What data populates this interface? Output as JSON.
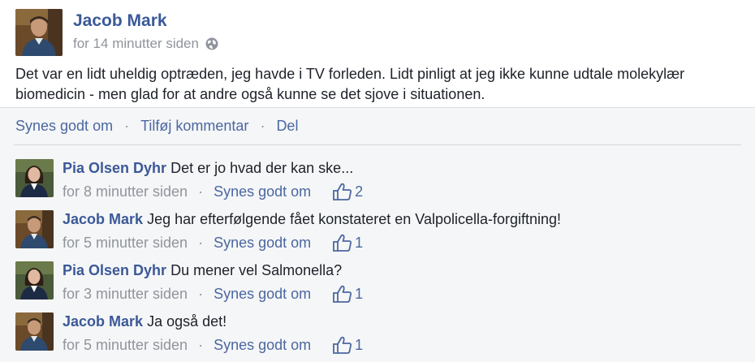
{
  "post": {
    "author": "Jacob Mark",
    "time": "for 14 minutter siden",
    "audience_icon": "globe-icon",
    "text": "Det var en lidt uheldig optræden, jeg havde i TV forleden. Lidt pinligt at jeg ikke kunne udtale molekylær biomedicin - men glad for at andre også kunne se det sjove i situationen."
  },
  "actions": {
    "like": "Synes godt om",
    "comment": "Tilføj kommentar",
    "share": "Del",
    "separator": "·"
  },
  "comments": [
    {
      "author": "Pia Olsen Dyhr",
      "text": "Det er jo hvad der kan ske...",
      "time": "for 8 minutter siden",
      "like_label": "Synes godt om",
      "likes": "2",
      "avatar": "female"
    },
    {
      "author": "Jacob Mark",
      "text": "Jeg har efterfølgende fået konstateret en Valpolicella-forgiftning!",
      "time": "for 5 minutter siden",
      "like_label": "Synes godt om",
      "likes": "1",
      "avatar": "male"
    },
    {
      "author": "Pia Olsen Dyhr",
      "text": "Du mener vel Salmonella?",
      "time": "for 3 minutter siden",
      "like_label": "Synes godt om",
      "likes": "1",
      "avatar": "female"
    },
    {
      "author": "Jacob Mark",
      "text": "Ja også det!",
      "time": "for 5 minutter siden",
      "like_label": "Synes godt om",
      "likes": "1",
      "avatar": "male"
    }
  ],
  "colors": {
    "link": "#3b5998",
    "action": "#4b67a1",
    "meta": "#90949c",
    "feedback_bg": "#f5f6f7"
  }
}
